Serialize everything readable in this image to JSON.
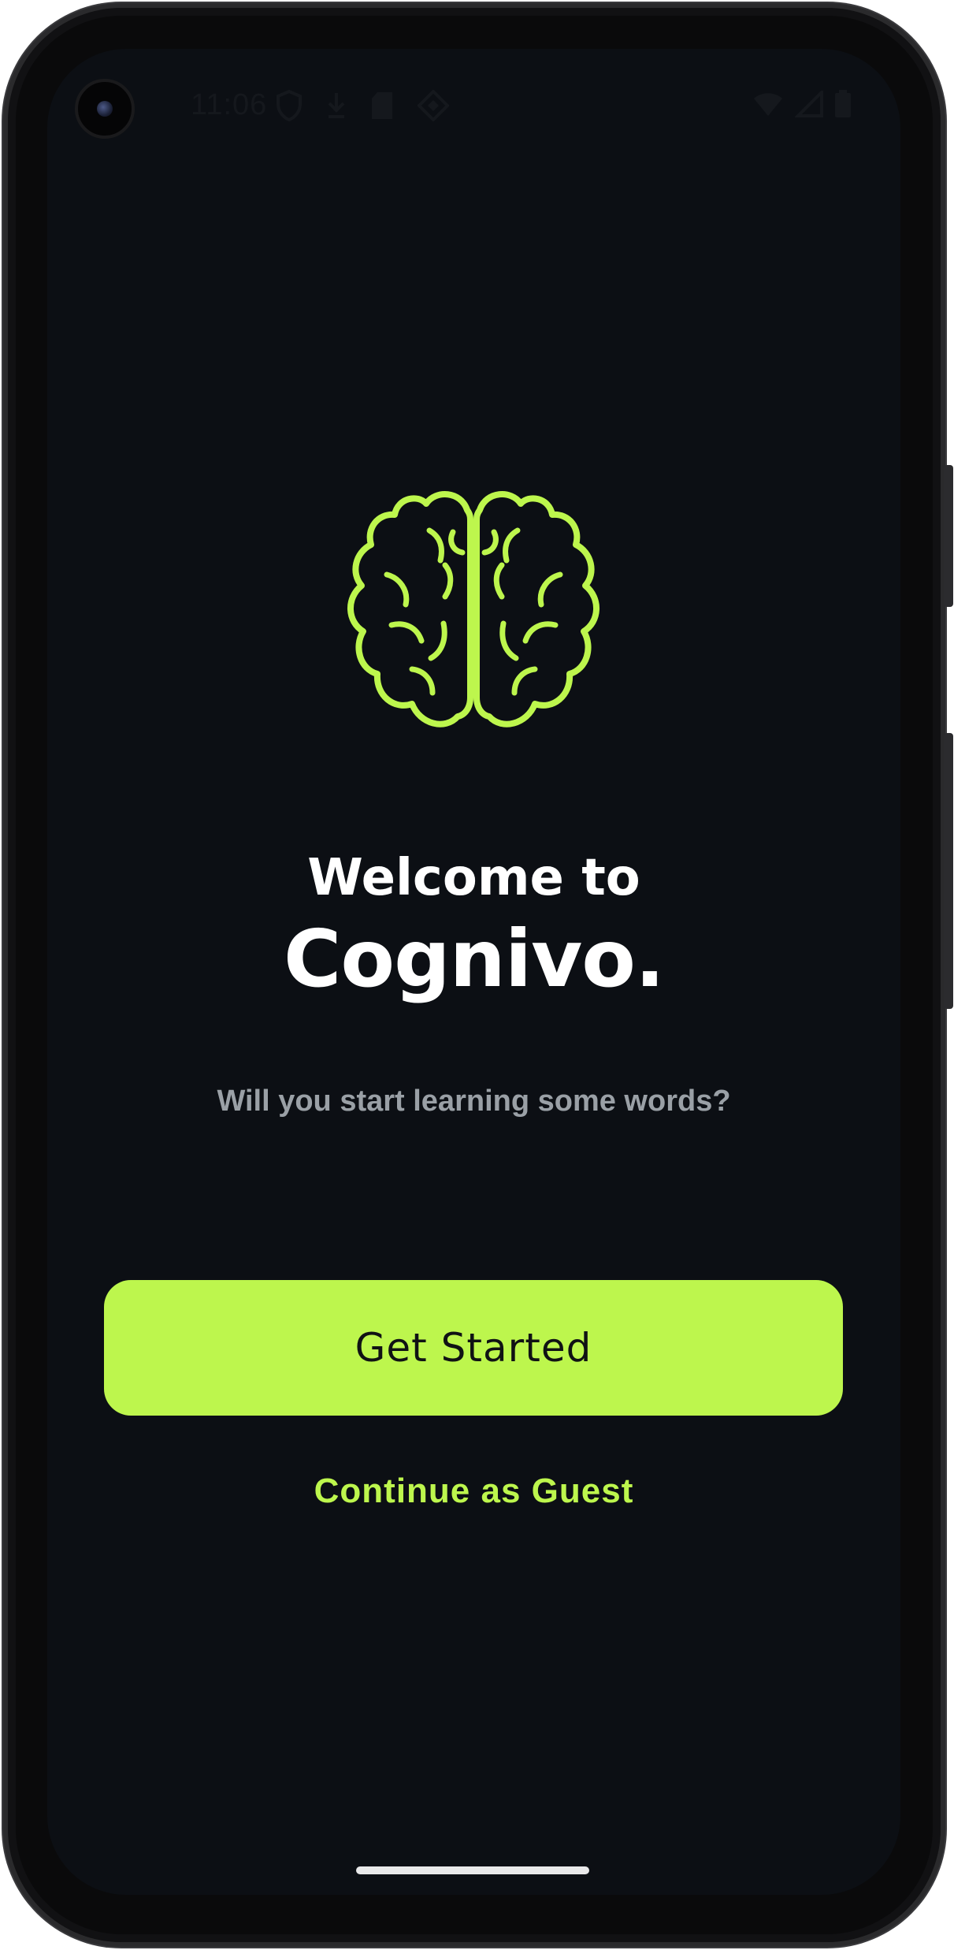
{
  "status_bar": {
    "time": "11:06",
    "left_icons": [
      "shield-icon",
      "download-icon",
      "sd-card-icon",
      "sync-diamond-icon"
    ],
    "right_icons": [
      "wifi-icon",
      "signal-icon",
      "battery-icon"
    ]
  },
  "logo": {
    "icon": "brain-icon",
    "color": "#bdf64d"
  },
  "welcome": {
    "line1": "Welcome to",
    "app_name": "Cognivo."
  },
  "subtitle": "Will you start learning some words?",
  "actions": {
    "primary_label": "Get Started",
    "secondary_label": "Continue as Guest"
  },
  "colors": {
    "accent": "#bdf64d",
    "background": "#0c0f14",
    "subtitle_text": "#9aa0a6"
  }
}
